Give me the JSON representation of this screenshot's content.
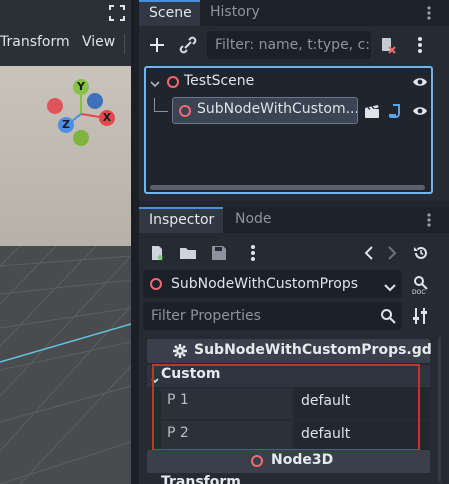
{
  "viewport": {
    "menu": [
      "Transform",
      "View"
    ],
    "gizmo": {
      "x": "X",
      "y": "Y",
      "z": "Z"
    }
  },
  "scene_dock": {
    "tabs": [
      "Scene",
      "History"
    ],
    "filter_placeholder": "Filter: name, t:type, c:group",
    "tree": [
      {
        "label": "TestScene"
      },
      {
        "label": "SubNodeWithCustom..."
      }
    ]
  },
  "inspector": {
    "tabs": [
      "Inspector",
      "Node"
    ],
    "object_name": "SubNodeWithCustomProps",
    "filter_placeholder": "Filter Properties",
    "script_header": "SubNodeWithCustomProps.gd",
    "group": "Custom",
    "properties": [
      {
        "label": "P 1",
        "value": "default"
      },
      {
        "label": "P 2",
        "value": "default"
      }
    ],
    "node3d_header": "Node3D",
    "transform_header": "Transform"
  },
  "colors": {
    "accent": "#4a90d6",
    "node_red": "#ef6b70",
    "highlight_box": "#c8312f"
  }
}
